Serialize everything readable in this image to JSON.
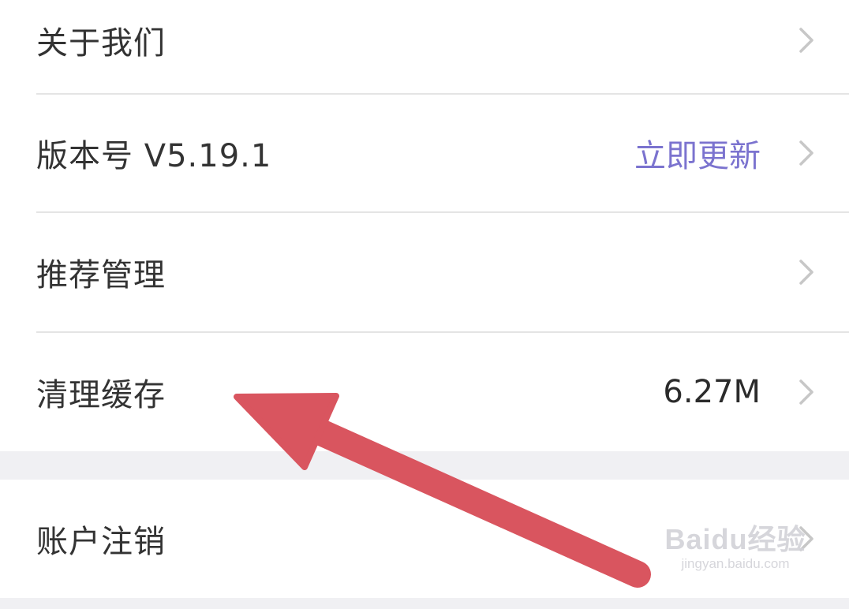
{
  "settings": {
    "items": [
      {
        "label": "关于我们",
        "value": ""
      },
      {
        "label": "版本号 V5.19.1",
        "value": "立即更新"
      },
      {
        "label": "推荐管理",
        "value": ""
      },
      {
        "label": "清理缓存",
        "value": "6.27M"
      },
      {
        "label": "账户注销",
        "value": ""
      }
    ]
  },
  "colors": {
    "accent": "#7b73cf",
    "arrow": "#d9555f",
    "section_gap": "#f0f0f3",
    "divider": "#e4e4e4"
  },
  "icons": {
    "chevron": "chevron-right-icon",
    "annotation": "arrow-icon"
  },
  "watermark": {
    "logo": "Baidu经验",
    "url": "jingyan.baidu.com"
  }
}
